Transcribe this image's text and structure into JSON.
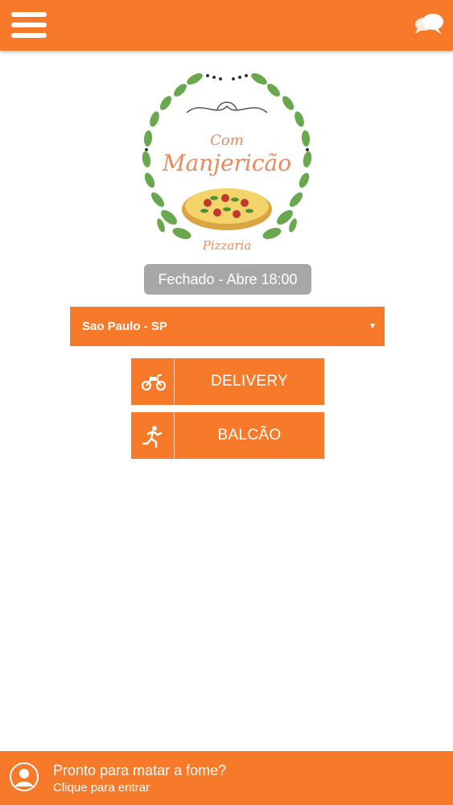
{
  "header": {
    "menu_icon": "hamburger-menu-icon",
    "chat_icon": "chat-bubbles-icon"
  },
  "logo": {
    "line1": "Com",
    "line2": "Manjericão",
    "line3": "Pizzaria"
  },
  "status": {
    "text": "Fechado - Abre 18:00"
  },
  "city_select": {
    "value": "Sao Paulo - SP",
    "caret": "▼"
  },
  "actions": [
    {
      "label": "DELIVERY",
      "icon": "motorcycle-icon"
    },
    {
      "label": "BALCÃO",
      "icon": "running-person-icon"
    }
  ],
  "footer": {
    "title": "Pronto para matar a fome?",
    "subtitle": "Clique para entrar",
    "icon": "user-avatar-icon"
  },
  "colors": {
    "accent": "#f7792a",
    "status_bg": "#a7a7a7",
    "logo_text": "#e98a5a",
    "leaf": "#6aa84f"
  }
}
